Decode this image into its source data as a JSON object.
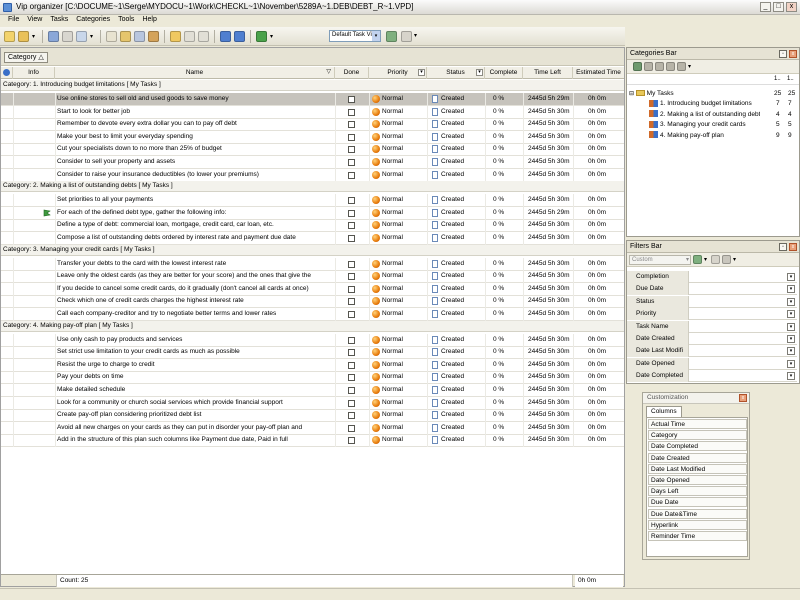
{
  "window": {
    "title": "Vip organizer [C:\\DOCUME~1\\Serge\\MYDOCU~1\\Work\\CHECKL~1\\November\\5289A~1.DEB\\DEBT_R~1.VPD]",
    "min": "_",
    "max": "□",
    "close": "x"
  },
  "menu": [
    "File",
    "View",
    "Tasks",
    "Categories",
    "Tools",
    "Help"
  ],
  "toolbar": {
    "view_select": "Default Task View",
    "view_arrow": "▾"
  },
  "grouping": {
    "chip_label": "Category",
    "chip_sort": "△"
  },
  "columns": {
    "info": "Info",
    "name": "Name",
    "done": "Done",
    "priority": "Priority",
    "status": "Status",
    "complete": "Complete",
    "time_left": "Time Left",
    "estimated_time": "Estimated Time"
  },
  "groups": [
    {
      "label": "Category: 1. Introducing budget limitations    [ My Tasks ]",
      "tasks": [
        {
          "name": "Use online stores to sell old and used goods to save money",
          "priority": "Normal",
          "status": "Created",
          "complete": "0 %",
          "time_left": "2445d 5h 29m",
          "est": "0h 0m"
        },
        {
          "name": "Start to look for better job",
          "priority": "Normal",
          "status": "Created",
          "complete": "0 %",
          "time_left": "2445d 5h 30m",
          "est": "0h 0m"
        },
        {
          "name": "Remember to devote every extra dollar you can to pay off debt",
          "priority": "Normal",
          "status": "Created",
          "complete": "0 %",
          "time_left": "2445d 5h 30m",
          "est": "0h 0m"
        },
        {
          "name": "Make your best to limit your everyday spending",
          "priority": "Normal",
          "status": "Created",
          "complete": "0 %",
          "time_left": "2445d 5h 30m",
          "est": "0h 0m"
        },
        {
          "name": "Cut your specialists down to no more than 25% of budget",
          "priority": "Normal",
          "status": "Created",
          "complete": "0 %",
          "time_left": "2445d 5h 30m",
          "est": "0h 0m"
        },
        {
          "name": "Consider to sell your property and assets",
          "priority": "Normal",
          "status": "Created",
          "complete": "0 %",
          "time_left": "2445d 5h 30m",
          "est": "0h 0m"
        },
        {
          "name": "Consider to raise your insurance deductibles (to lower your premiums)",
          "priority": "Normal",
          "status": "Created",
          "complete": "0 %",
          "time_left": "2445d 5h 30m",
          "est": "0h 0m"
        }
      ]
    },
    {
      "label": "Category: 2. Making a list of outstanding debts    [ My Tasks ]",
      "tasks": [
        {
          "name": "Set priorities to all your payments",
          "priority": "Normal",
          "status": "Created",
          "complete": "0 %",
          "time_left": "2445d 5h 30m",
          "est": "0h 0m"
        },
        {
          "name": "For each of the defined debt type, gather the following info:",
          "priority": "Normal",
          "status": "Created",
          "complete": "0 %",
          "time_left": "2445d 5h 29m",
          "est": "0h 0m",
          "flag": true
        },
        {
          "name": "Define a type of debt: commercial loan, mortgage, credit card, car loan, etc.",
          "priority": "Normal",
          "status": "Created",
          "complete": "0 %",
          "time_left": "2445d 5h 30m",
          "est": "0h 0m"
        },
        {
          "name": "Compose a list of outstanding debts ordered by interest rate and payment due date",
          "priority": "Normal",
          "status": "Created",
          "complete": "0 %",
          "time_left": "2445d 5h 30m",
          "est": "0h 0m"
        }
      ]
    },
    {
      "label": "Category: 3. Managing your credit cards    [ My Tasks ]",
      "tasks": [
        {
          "name": "Transfer your debts to the card with the lowest interest rate",
          "priority": "Normal",
          "status": "Created",
          "complete": "0 %",
          "time_left": "2445d 5h 30m",
          "est": "0h 0m"
        },
        {
          "name": "Leave only the oldest cards (as they are better for your score) and the ones that give the",
          "priority": "Normal",
          "status": "Created",
          "complete": "0 %",
          "time_left": "2445d 5h 30m",
          "est": "0h 0m"
        },
        {
          "name": "If you decide to cancel some credit cards, do it gradually (don't cancel all cards at once)",
          "priority": "Normal",
          "status": "Created",
          "complete": "0 %",
          "time_left": "2445d 5h 30m",
          "est": "0h 0m"
        },
        {
          "name": "Check which one of credit cards charges the highest interest rate",
          "priority": "Normal",
          "status": "Created",
          "complete": "0 %",
          "time_left": "2445d 5h 30m",
          "est": "0h 0m"
        },
        {
          "name": "Call each company-creditor and try to negotiate better terms and lower rates",
          "priority": "Normal",
          "status": "Created",
          "complete": "0 %",
          "time_left": "2445d 5h 30m",
          "est": "0h 0m"
        }
      ]
    },
    {
      "label": "Category: 4. Making pay-off plan    [ My Tasks ]",
      "tasks": [
        {
          "name": "Use only cash to pay products and services",
          "priority": "Normal",
          "status": "Created",
          "complete": "0 %",
          "time_left": "2445d 5h 30m",
          "est": "0h 0m"
        },
        {
          "name": "Set strict use limitation to your credit cards as much as possible",
          "priority": "Normal",
          "status": "Created",
          "complete": "0 %",
          "time_left": "2445d 5h 30m",
          "est": "0h 0m"
        },
        {
          "name": "Resist the urge to charge to credit",
          "priority": "Normal",
          "status": "Created",
          "complete": "0 %",
          "time_left": "2445d 5h 30m",
          "est": "0h 0m"
        },
        {
          "name": "Pay your debts on time",
          "priority": "Normal",
          "status": "Created",
          "complete": "0 %",
          "time_left": "2445d 5h 30m",
          "est": "0h 0m"
        },
        {
          "name": "Make detailed schedule",
          "priority": "Normal",
          "status": "Created",
          "complete": "0 %",
          "time_left": "2445d 5h 30m",
          "est": "0h 0m"
        },
        {
          "name": "Look for a community or church social services which provide financial support",
          "priority": "Normal",
          "status": "Created",
          "complete": "0 %",
          "time_left": "2445d 5h 30m",
          "est": "0h 0m"
        },
        {
          "name": "Create pay-off plan considering prioritized debt list",
          "priority": "Normal",
          "status": "Created",
          "complete": "0 %",
          "time_left": "2445d 5h 30m",
          "est": "0h 0m"
        },
        {
          "name": "Avoid all new charges on your cards as they can put in disorder your pay-off plan and",
          "priority": "Normal",
          "status": "Created",
          "complete": "0 %",
          "time_left": "2445d 5h 30m",
          "est": "0h 0m"
        },
        {
          "name": "Add in the structure of this plan such columns like Payment due date, Paid in full",
          "priority": "Normal",
          "status": "Created",
          "complete": "0 %",
          "time_left": "2445d 5h 30m",
          "est": "0h 0m"
        }
      ]
    }
  ],
  "footer": {
    "count": "Count: 25",
    "total": "0h 0m"
  },
  "categories_bar": {
    "title": "Categories Bar",
    "col1": "1..",
    "col2": "1..",
    "root": {
      "name": "My Tasks",
      "a": "25",
      "b": "25"
    },
    "items": [
      {
        "name": "1. Introducing budget limitations",
        "a": "7",
        "b": "7"
      },
      {
        "name": "2. Making a list of outstanding debts",
        "a": "4",
        "b": "4"
      },
      {
        "name": "3. Managing your credit cards",
        "a": "5",
        "b": "5"
      },
      {
        "name": "4. Making pay-off plan",
        "a": "9",
        "b": "9"
      }
    ]
  },
  "filters_bar": {
    "title": "Filters Bar",
    "select": "Custom",
    "rows": [
      "Completion",
      "Due Date",
      "Status",
      "Priority",
      "Task Name",
      "Date Created",
      "Date Last Modifi",
      "Date Opened",
      "Date Completed"
    ]
  },
  "customization": {
    "title": "Customization",
    "tab": "Columns",
    "items": [
      "Actual Time",
      "Category",
      "Date Completed",
      "Date Created",
      "Date Last Modified",
      "Date Opened",
      "Days Left",
      "Due Date",
      "Due Date&Time",
      "Hyperlink",
      "Reminder Time"
    ]
  },
  "colors": {
    "selected_row": "#c6c3bc",
    "priority": "#e87c0c",
    "panel_bg": "#ece9d8"
  }
}
